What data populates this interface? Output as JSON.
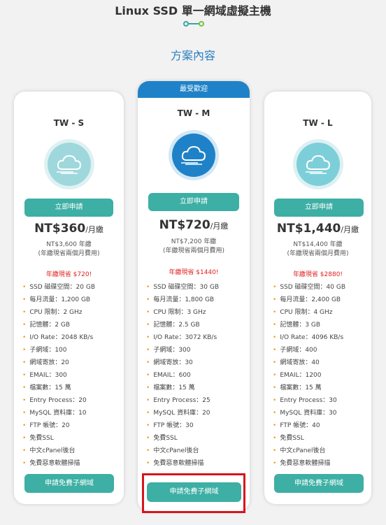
{
  "header": {
    "title": "Linux SSD 單一網域虛擬主機",
    "section_title": "方案內容"
  },
  "colors": {
    "accent_teal": "#3dafa4",
    "ribbon_blue": "#1f82c8",
    "save_red": "#e02020",
    "highlight_red": "#d8141c"
  },
  "plans": [
    {
      "name": "TW - S",
      "apply_label": "立即申請",
      "price": "NT$360",
      "price_unit": "/月繳",
      "yearly_price": "NT$3,600 年繳",
      "yearly_note": "(年繳現省兩個月費用)",
      "save_text": "年繳現省 $720!",
      "features": [
        "SSD 磁碟空間：20 GB",
        "每月流量：1,200 GB",
        "CPU 限制：2 GHz",
        "記憶體：2 GB",
        "I/O Rate：2048 KB/s",
        "子網域：100",
        "網域寄放：20",
        "EMAIL：300",
        "檔案數：15 萬",
        "Entry Process：20",
        "MySQL 資料庫：10",
        "FTP 帳號：20",
        "免費SSL",
        "中文cPanel後台",
        "免費惡意軟體掃描"
      ],
      "domain_label": "申請免費子網域",
      "icon": "cloud-icon"
    },
    {
      "ribbon": "最受歡迎",
      "name": "TW - M",
      "apply_label": "立即申請",
      "price": "NT$720",
      "price_unit": "/月繳",
      "yearly_price": "NT$7,200 年繳",
      "yearly_note": "(年繳現省兩個月費用)",
      "save_text": "年繳現省 $1440!",
      "features": [
        "SSD 磁碟空間：30 GB",
        "每月流量：1,800 GB",
        "CPU 限制：3 GHz",
        "記憶體：2.5 GB",
        "I/O Rate：3072 KB/s",
        "子網域：300",
        "網域寄放：30",
        "EMAIL：600",
        "檔案數：15 萬",
        "Entry Process：25",
        "MySQL 資料庫：20",
        "FTP 帳號：30",
        "免費SSL",
        "中文cPanel後台",
        "免費惡意軟體掃描"
      ],
      "domain_label": "申請免費子網域",
      "icon": "cloud-icon"
    },
    {
      "name": "TW - L",
      "apply_label": "立即申請",
      "price": "NT$1,440",
      "price_unit": "/月繳",
      "yearly_price": "NT$14,400 年繳",
      "yearly_note": "(年繳現省兩個月費用)",
      "save_text": "年繳現省 $2880!",
      "features": [
        "SSD 磁碟空間：40 GB",
        "每月流量：2,400 GB",
        "CPU 限制：4 GHz",
        "記憶體：3 GB",
        "I/O Rate：4096 KB/s",
        "子網域：400",
        "網域寄放：40",
        "EMAIL：1200",
        "檔案數：15 萬",
        "Entry Process：30",
        "MySQL 資料庫：30",
        "FTP 帳號：40",
        "免費SSL",
        "中文cPanel後台",
        "免費惡意軟體掃描"
      ],
      "domain_label": "申請免費子網域",
      "icon": "cloud-icon"
    }
  ]
}
